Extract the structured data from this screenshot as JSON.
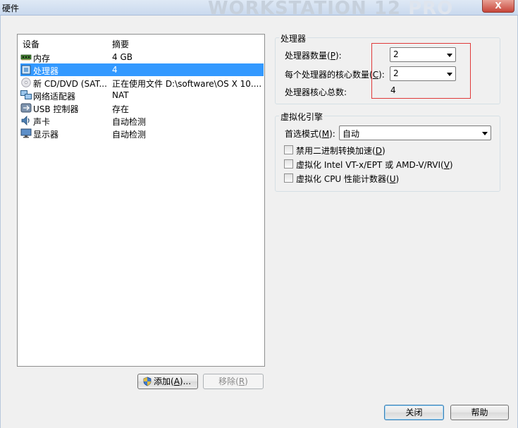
{
  "window": {
    "title": "硬件",
    "watermark": "WORKSTATION 12",
    "watermark_pro": "PRO",
    "close_label": "X"
  },
  "hardware_list": {
    "headers": {
      "device": "设备",
      "summary": "摘要"
    },
    "items": [
      {
        "label": "内存",
        "summary": "4 GB",
        "icon": "memory-icon"
      },
      {
        "label": "处理器",
        "summary": "4",
        "icon": "processor-icon",
        "selected": true
      },
      {
        "label": "新 CD/DVD (SAT...",
        "summary": "正在使用文件 D:\\software\\OS X 10....",
        "icon": "cd-dvd-icon"
      },
      {
        "label": "网络适配器",
        "summary": "NAT",
        "icon": "network-adapter-icon"
      },
      {
        "label": "USB 控制器",
        "summary": "存在",
        "icon": "usb-icon"
      },
      {
        "label": "声卡",
        "summary": "自动检测",
        "icon": "sound-card-icon"
      },
      {
        "label": "显示器",
        "summary": "自动检测",
        "icon": "display-icon"
      }
    ],
    "add_button": {
      "label": "添加",
      "mnemonic": "A",
      "suffix": ")..."
    },
    "remove_button": {
      "label": "移除",
      "mnemonic": "R"
    }
  },
  "processors": {
    "group_title": "处理器",
    "count_label": "处理器数量",
    "count_mnemonic": "P",
    "count_value": "2",
    "cores_label": "每个处理器的核心数量",
    "cores_mnemonic": "C",
    "cores_value": "2",
    "total_label": "处理器核心总数:",
    "total_value": "4"
  },
  "virtualization": {
    "group_title": "虚拟化引擎",
    "mode_label": "首选模式",
    "mode_mnemonic": "M",
    "mode_value": "自动",
    "options": [
      {
        "label": "禁用二进制转换加速",
        "mnemonic": "D",
        "checked": false
      },
      {
        "label": "虚拟化 Intel VT-x/EPT 或 AMD-V/RVI",
        "mnemonic": "V",
        "checked": false
      },
      {
        "label": "虚拟化 CPU 性能计数器",
        "mnemonic": "U",
        "checked": false
      }
    ]
  },
  "footer": {
    "close_label": "关闭",
    "help_label": "帮助"
  },
  "colors": {
    "selection": "#3399ff",
    "highlight_box": "#e03a3a"
  }
}
